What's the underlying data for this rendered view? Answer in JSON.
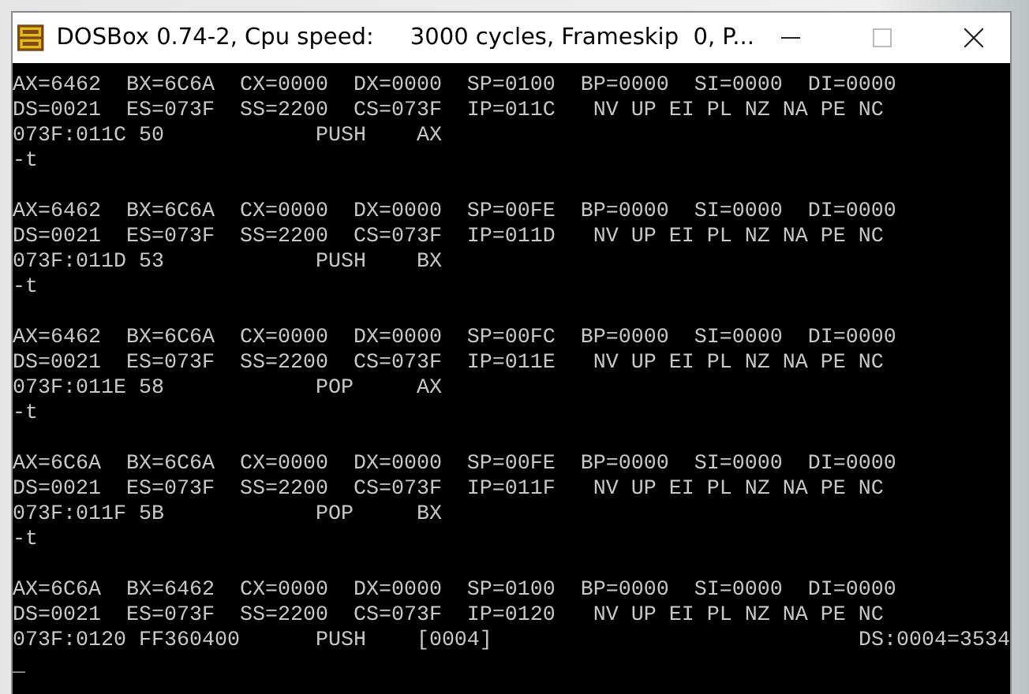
{
  "window": {
    "title": "DOSBox 0.74-2, Cpu speed:     3000 cycles, Frameskip  0, P..."
  },
  "terminal": {
    "blocks": [
      {
        "registers": "AX=6462  BX=6C6A  CX=0000  DX=0000  SP=0100  BP=0000  SI=0000  DI=0000",
        "segments": "DS=0021  ES=073F  SS=2200  CS=073F  IP=011C   NV UP EI PL NZ NA PE NC",
        "instruction": "073F:011C 50            PUSH    AX",
        "prompt": "-t"
      },
      {
        "registers": "AX=6462  BX=6C6A  CX=0000  DX=0000  SP=00FE  BP=0000  SI=0000  DI=0000",
        "segments": "DS=0021  ES=073F  SS=2200  CS=073F  IP=011D   NV UP EI PL NZ NA PE NC",
        "instruction": "073F:011D 53            PUSH    BX",
        "prompt": "-t"
      },
      {
        "registers": "AX=6462  BX=6C6A  CX=0000  DX=0000  SP=00FC  BP=0000  SI=0000  DI=0000",
        "segments": "DS=0021  ES=073F  SS=2200  CS=073F  IP=011E   NV UP EI PL NZ NA PE NC",
        "instruction": "073F:011E 58            POP     AX",
        "prompt": "-t"
      },
      {
        "registers": "AX=6C6A  BX=6C6A  CX=0000  DX=0000  SP=00FE  BP=0000  SI=0000  DI=0000",
        "segments": "DS=0021  ES=073F  SS=2200  CS=073F  IP=011F   NV UP EI PL NZ NA PE NC",
        "instruction": "073F:011F 5B            POP     BX",
        "prompt": "-t"
      },
      {
        "registers": "AX=6C6A  BX=6462  CX=0000  DX=0000  SP=0100  BP=0000  SI=0000  DI=0000",
        "segments": "DS=0021  ES=073F  SS=2200  CS=073F  IP=0120   NV UP EI PL NZ NA PE NC",
        "instruction": "073F:0120 FF360400      PUSH    [0004]",
        "memory": "DS:0004=3534",
        "prompt": "_"
      }
    ]
  }
}
